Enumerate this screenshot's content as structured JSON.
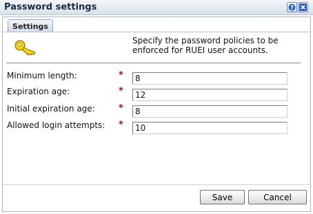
{
  "window": {
    "title": "Password settings"
  },
  "tabs": [
    {
      "label": "Settings"
    }
  ],
  "description": "Specify the password policies to be enforced for RUEI user accounts.",
  "required_marker": "*",
  "fields": [
    {
      "label": "Minimum length:",
      "value": "8"
    },
    {
      "label": "Expiration age:",
      "value": "12"
    },
    {
      "label": "Initial expiration age:",
      "value": "8"
    },
    {
      "label": "Allowed login attempts:",
      "value": "10"
    }
  ],
  "buttons": {
    "save": "Save",
    "cancel": "Cancel"
  },
  "colors": {
    "required": "#c4001a",
    "key_icon": "#e8c200"
  },
  "icons": {
    "help": "help-icon",
    "close": "close-icon",
    "key": "key-icon"
  }
}
